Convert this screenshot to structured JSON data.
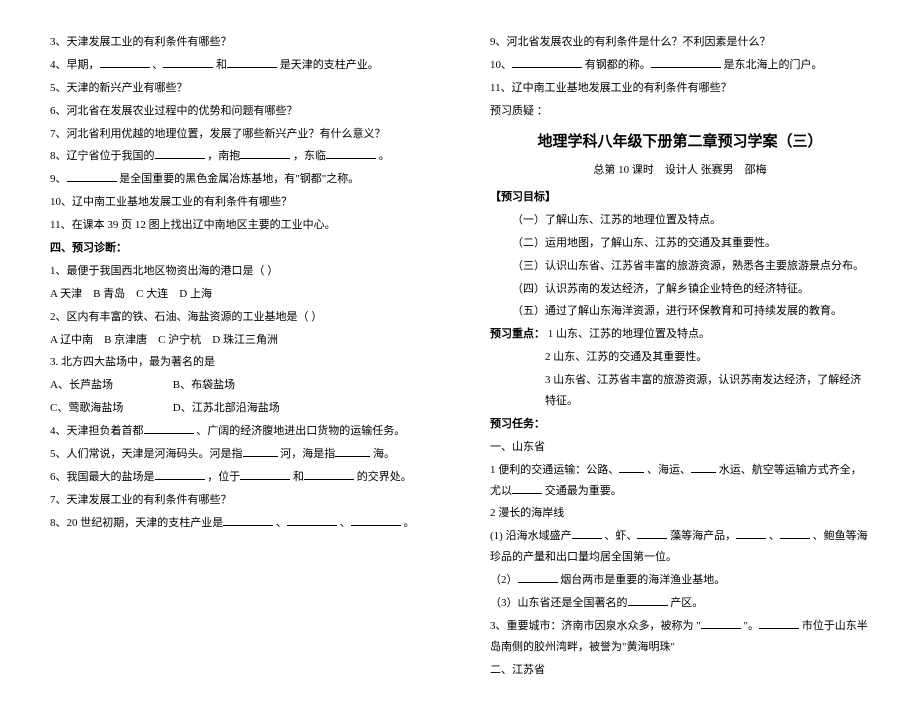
{
  "left": {
    "q3": "3、天津发展工业的有利条件有哪些？",
    "q4a": "4、早期，",
    "q4b": "、",
    "q4c": "和",
    "q4d": "是天津的支柱产业。",
    "q5": "5、天津的新兴产业有哪些？",
    "q6": "6、河北省在发展农业过程中的优势和问题有哪些？",
    "q7": "7、河北省利用优越的地理位置，发展了哪些新兴产业？有什么意义？",
    "q8a": "8、辽宁省位于我国的",
    "q8b": "，南抱",
    "q8c": "，东临",
    "q8d": "。",
    "q9a": "9、",
    "q9b": "是全国重要的黑色金属冶炼基地，有\"钢都\"之称。",
    "q10": "10、辽中南工业基地发展工业的有利条件有哪些？",
    "q11": "11、在课本 39 页 12 图上找出辽中南地区主要的工业中心。",
    "secHead": "四、预习诊断：",
    "d1": "1、最便于我国西北地区物资出海的港口是（  ）",
    "d1opt": "A  天津 B  青岛 C  大连 D  上海",
    "d2": "2、区内有丰富的铁、石油、海盐资源的工业基地是（  ）",
    "d2opt": "A  辽中南 B  京津唐 C  沪宁杭 D  珠江三角洲",
    "d3": "3. 北方四大盐场中，最为著名的是",
    "d3a": "A、长芦盐场",
    "d3b": "B、布袋盐场",
    "d3c": "C、莺歌海盐场",
    "d3d": "D、江苏北部沿海盐场",
    "d4a": "4、天津担负着首都",
    "d4b": "、广阔的经济腹地进出口货物的运输任务。",
    "d5a": "5、人们常说，天津是河海码头。河是指",
    "d5b": "河，海是指",
    "d5c": "海。",
    "d6a": "6、我国最大的盐场是",
    "d6b": "，位于",
    "d6c": "和",
    "d6d": "的交界处。",
    "d7": "7、天津发展工业的有利条件有哪些？",
    "d8a": "8、20 世纪初期，天津的支柱产业是",
    "d8b": "、",
    "d8c": "、",
    "d8d": "。"
  },
  "right": {
    "q9": "9、河北省发展农业的有利条件是什么？不利因素是什么？",
    "q10a": "10、",
    "q10b": "有钢都的称。",
    "q10c": "是东北海上的门户。",
    "q11": "11、辽中南工业基地发展工业的有利条件有哪些？",
    "pre": "预习质疑 ：",
    "title": "地理学科八年级下册第二章预习学案（三）",
    "subtitle": "总第 10 课时 设计人  张赛男 邵梅",
    "goalsHead": "【预习目标】",
    "g1": "（一）了解山东、江苏的地理位置及特点。",
    "g2": "（二）运用地图，了解山东、江苏的交通及其重要性。",
    "g3": "（三）认识山东省、江苏省丰富的旅游资源，熟悉各主要旅游景点分布。",
    "g4": "（四）认识苏南的发达经济，了解乡镇企业特色的经济特征。",
    "g5": "（五）通过了解山东海洋资源，进行环保教育和可持续发展的教育。",
    "pointsHead": "预习重点：",
    "p1": "1 山东、江苏的地理位置及特点。",
    "p2": "2 山东、江苏的交通及其重要性。",
    "p3": "3 山东省、江苏省丰富的旅游资源，认识苏南发达经济，了解经济特征。",
    "tasksHead": "预习任务：",
    "t0": "一、山东省",
    "t1a": "1 便利的交通运输：公路、",
    "t1b": "、海运、",
    "t1c": "水运、航空等运输方式齐全，尤以",
    "t1d": "交通最为重要。",
    "t2": "2 漫长的海岸线",
    "t2_1a": "(1) 沿海水域盛产",
    "t2_1b": "、虾、",
    "t2_1c": "藻等海产品，",
    "t2_1d": "、",
    "t2_1e": "、鲍鱼等海珍品的产量和出口量均居全国第一位。",
    "t2_2a": "（2）",
    "t2_2b": "烟台两市是重要的海洋渔业基地。",
    "t2_3a": "（3）山东省还是全国著名的",
    "t2_3b": "产区。",
    "t3a": "3、重要城市：济南市因泉水众多，被称为 \"",
    "t3b": "\"。",
    "t3c": "市位于山东半岛南侧的胶州湾畔，被誉为\"黄海明珠\"",
    "tEnd": "二、江苏省"
  }
}
